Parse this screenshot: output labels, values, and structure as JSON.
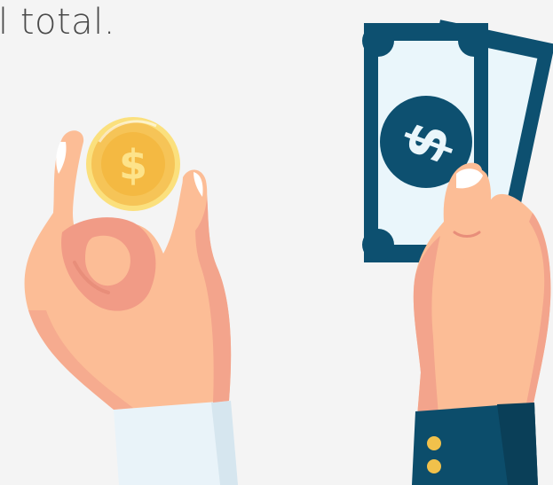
{
  "caption": "l total.",
  "illustration": {
    "coin_symbol": "$",
    "bill_symbol": "$",
    "icons": [
      "hand-holding-coin-icon",
      "gold-coin-icon",
      "hand-holding-banknotes-icon",
      "banknote-icon"
    ]
  },
  "colors": {
    "background": "#f4f4f4",
    "skin": "#fcbd96",
    "skin_shadow": "#f19b86",
    "coin_gold": "#f6c457",
    "coin_light": "#fbe07d",
    "bill_dark": "#0d5070",
    "bill_light": "#eaf6fb",
    "shirt_cuff": "#e7f1f7",
    "sleeve_navy": "#0c4d6b",
    "button_gold": "#f1c14b"
  }
}
